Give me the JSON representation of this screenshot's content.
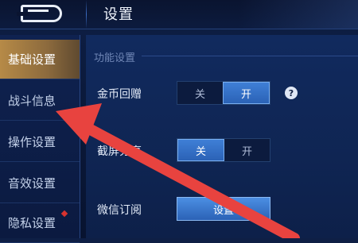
{
  "header": {
    "title": "设置"
  },
  "sidebar": {
    "items": [
      {
        "label": "基础设置"
      },
      {
        "label": "战斗信息"
      },
      {
        "label": "操作设置"
      },
      {
        "label": "音效设置"
      },
      {
        "label": "隐私设置"
      }
    ]
  },
  "panel": {
    "section_title": "功能设置",
    "rows": [
      {
        "label": "金币回赠",
        "off_label": "关",
        "on_label": "开",
        "state": "开"
      },
      {
        "label": "截屏分享",
        "off_label": "关",
        "on_label": "开",
        "state": "关"
      },
      {
        "label": "微信订阅",
        "button_label": "设置"
      }
    ],
    "help_glyph": "?"
  },
  "colors": {
    "active_tab": "#b68a47",
    "toggle_on": "#3f7fd6",
    "annotation_arrow": "#e8433f",
    "badge": "#d8332f"
  },
  "icons": [
    "back-icon",
    "help-icon",
    "notification-dot-icon"
  ]
}
